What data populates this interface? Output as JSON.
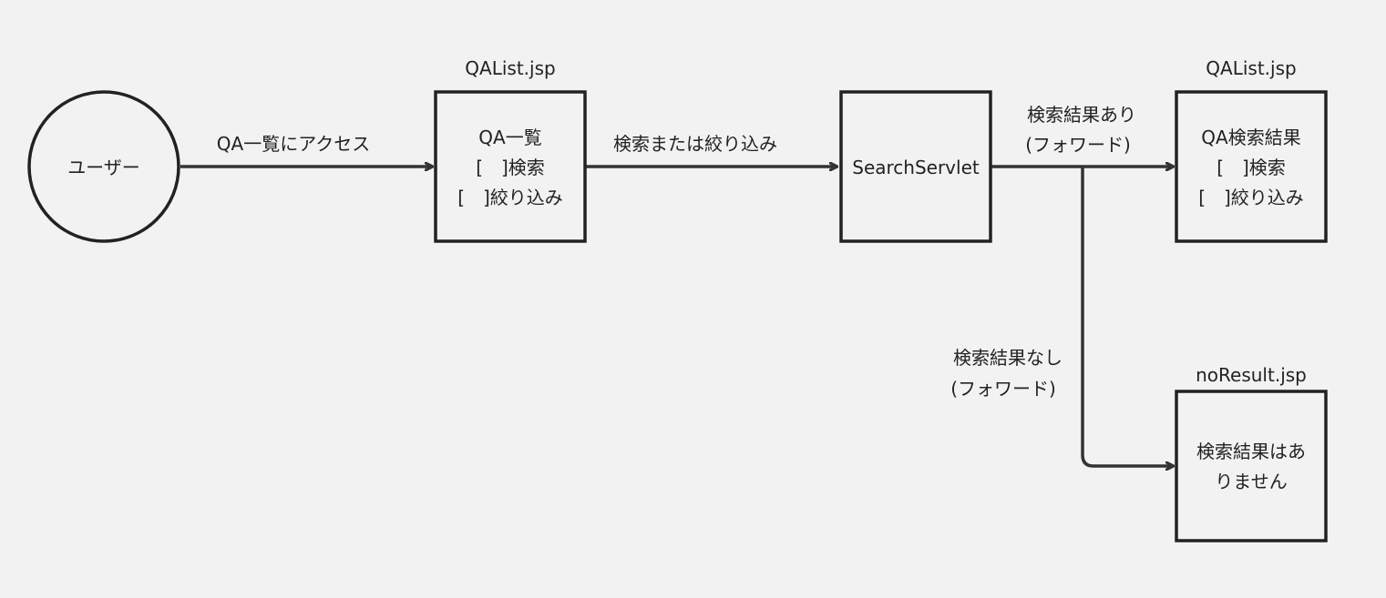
{
  "colors": {
    "background": "#f2f2f2",
    "stroke": "#333333",
    "text": "#222222"
  },
  "nodes": {
    "user": {
      "label": "ユーザー"
    },
    "qalist_page": {
      "title": "QAList.jsp",
      "lines": [
        "QA一覧",
        "[　]検索",
        "[　]絞り込み"
      ]
    },
    "search_servlet": {
      "label": "SearchServlet"
    },
    "qalist_result_page": {
      "title": "QAList.jsp",
      "lines": [
        "QA検索結果",
        "[　]検索",
        "[　]絞り込み"
      ]
    },
    "noresult_page": {
      "title": "noResult.jsp",
      "lines": [
        "検索結果はあ",
        "りません"
      ]
    }
  },
  "edges": {
    "access": {
      "label": "QA一覧にアクセス"
    },
    "search_or_filter": {
      "label": "検索または絞り込み"
    },
    "found": {
      "lines": [
        "検索結果あり",
        "(フォワード)"
      ]
    },
    "not_found": {
      "lines": [
        "検索結果なし",
        "(フォワード)"
      ]
    }
  }
}
